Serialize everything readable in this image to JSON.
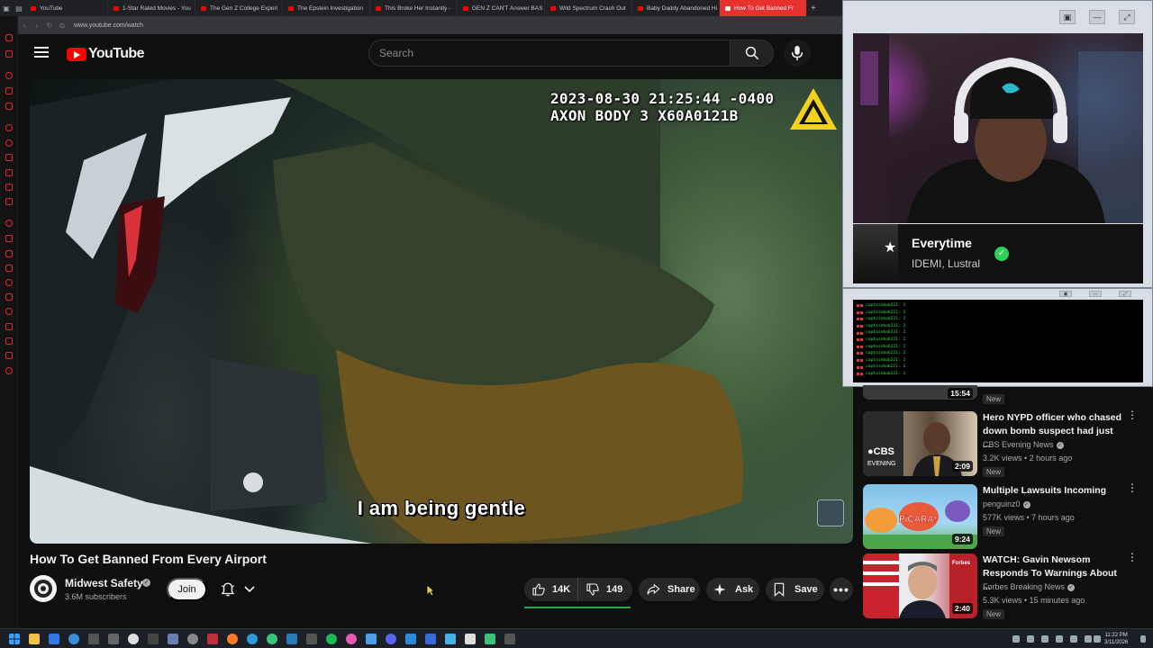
{
  "browser": {
    "tabs": [
      {
        "label": "YouTube"
      },
      {
        "label": "1-Star Rated Movies - You"
      },
      {
        "label": "The Gen Z College Experi"
      },
      {
        "label": "The Epstein Investigation"
      },
      {
        "label": "This Broke Her Instantly -"
      },
      {
        "label": "GEN Z CAN'T Answer BAS"
      },
      {
        "label": "Wild Spectrum Crash Out"
      },
      {
        "label": "Baby Daddy Abandoned Hi"
      },
      {
        "label": "How To Get Banned Fr"
      }
    ],
    "new_tab": "+",
    "url": "www.youtube.com/watch"
  },
  "header": {
    "logo_text": "YouTube",
    "search_placeholder": "Search"
  },
  "player": {
    "timestamp_line1": "2023-08-30 21:25:44 -0400",
    "timestamp_line2": "AXON BODY 3 X60A0121B",
    "subtitle": "I am being gentle"
  },
  "video": {
    "title": "How To Get Banned From Every Airport",
    "channel": "Midwest Safety",
    "subscribers": "3.6M subscribers",
    "join_label": "Join",
    "likes": "14K",
    "dislikes": "149",
    "like_ratio": 0.99,
    "share_label": "Share",
    "ask_label": "Ask",
    "save_label": "Save"
  },
  "now_playing": {
    "title": "Everytime",
    "artist": "IDEMI, Lustral"
  },
  "chat": {
    "lines": [
      {
        "user": "captainbob221:",
        "msg": "2"
      },
      {
        "user": "captainbob221:",
        "msg": "2"
      },
      {
        "user": "captainbob221:",
        "msg": "2"
      },
      {
        "user": "captainbob221:",
        "msg": "2"
      },
      {
        "user": "captainbob221:",
        "msg": "2"
      },
      {
        "user": "captainbob221:",
        "msg": "2"
      },
      {
        "user": "captainbob221:",
        "msg": "2"
      },
      {
        "user": "captainbob221:",
        "msg": "2"
      },
      {
        "user": "captainbob221:",
        "msg": "2"
      },
      {
        "user": "captainbob221:",
        "msg": "2"
      },
      {
        "user": "captainbob221:",
        "msg": "2"
      }
    ]
  },
  "recommendations": {
    "partial": {
      "duration": "15:54",
      "badge": "New"
    },
    "items": [
      {
        "title": "Hero NYPD officer who chased down bomb suspect had just ...",
        "channel": "CBS Evening News",
        "verified": true,
        "meta": "3.2K views • 2 hours ago",
        "badge": "New",
        "duration": "2:09"
      },
      {
        "title": "Multiple Lawsuits Incoming",
        "channel": "penguinz0",
        "verified": true,
        "meta": "577K views • 7 hours ago",
        "badge": "New",
        "duration": "9:24"
      },
      {
        "title": "WATCH: Gavin Newsom Responds To Warnings About ...",
        "channel": "Forbes Breaking News",
        "verified": true,
        "meta": "5.3K views • 15 minutes ago",
        "badge": "New",
        "duration": "2:40"
      }
    ]
  },
  "taskbar": {
    "time": "11:22 PM",
    "date": "3/11/2026"
  },
  "colors": {
    "youtube_red": "#ff0000",
    "like_bar": "#2ba640",
    "active_tab": "#e6312f",
    "chat_user": "#30e04a"
  }
}
